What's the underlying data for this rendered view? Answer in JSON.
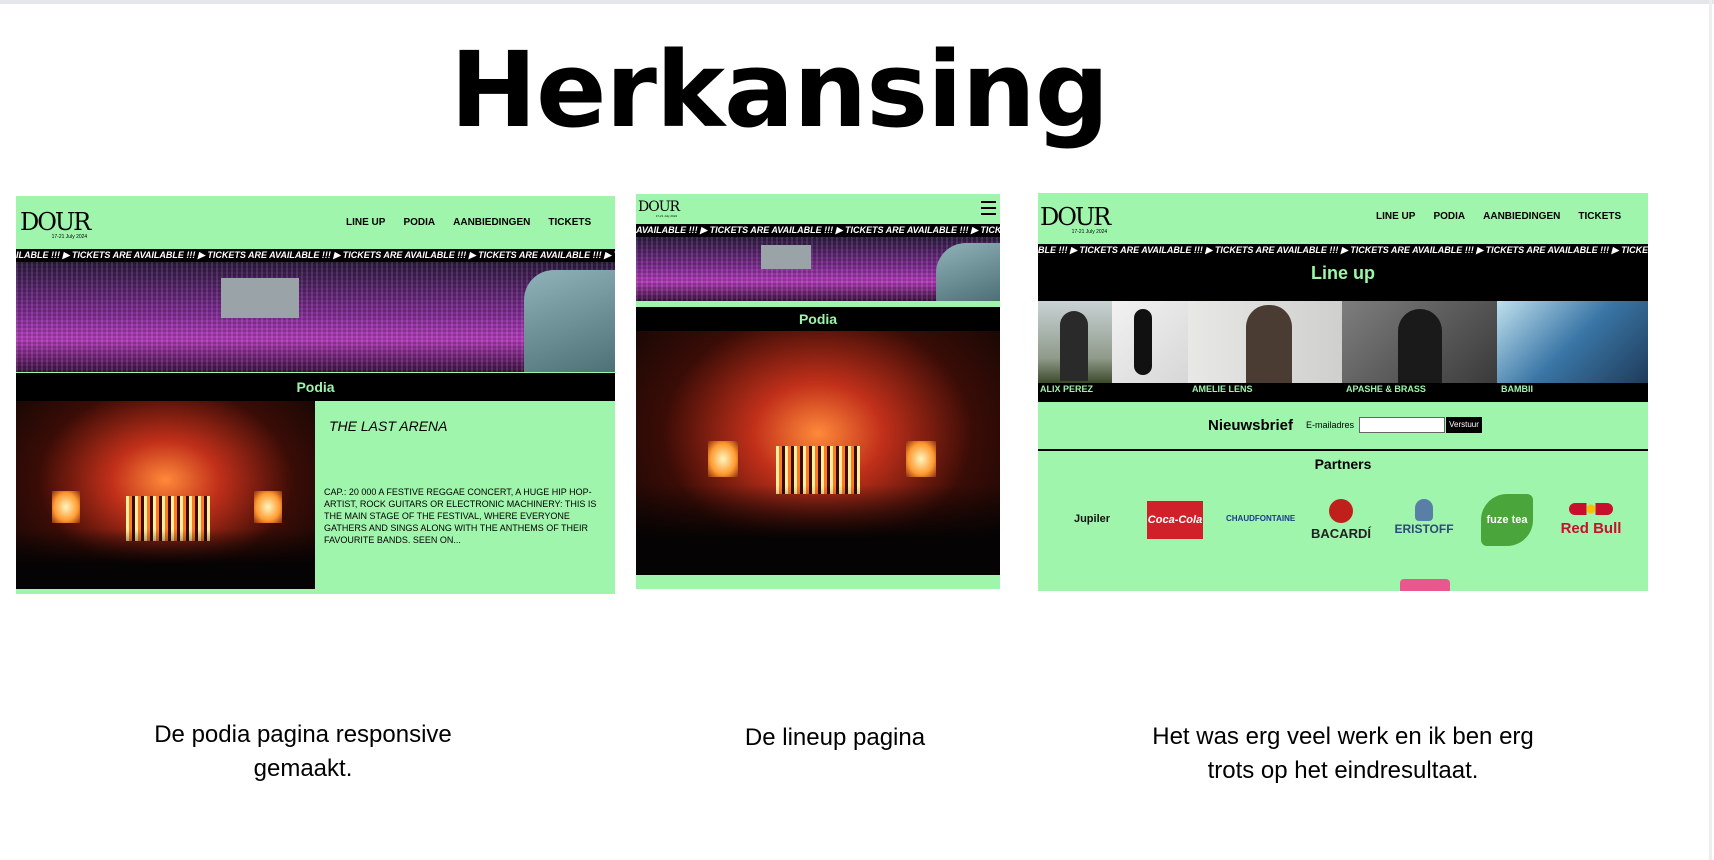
{
  "slide": {
    "title": "Herkansing",
    "captions": [
      "De podia pagina responsive gemaakt.",
      "De lineup pagina",
      "Het was erg veel werk en ik ben erg trots op het eindresultaat."
    ]
  },
  "site": {
    "logo": "DOUR",
    "logo_date": "17-21 July 2024",
    "logo_date_small": "17-21 July 2024",
    "nav": [
      "LINE UP",
      "PODIA",
      "AANBIEDINGEN",
      "TICKETS"
    ],
    "ticker_1": "ILABLE !!! ▶ TICKETS ARE AVAILABLE !!! ▶ TICKETS ARE AVAILABLE !!! ▶ TICKETS ARE AVAILABLE !!! ▶ TICKETS ARE AVAILABLE !!! ▶ TICKE",
    "ticker_2": "AVAILABLE !!! ▶ TICKETS ARE AVAILABLE !!! ▶ TICKETS ARE AVAILABLE !!! ▶ TICKETS",
    "ticker_3": "BLE !!! ▶ TICKETS ARE AVAILABLE !!! ▶ TICKETS ARE AVAILABLE !!! ▶ TICKETS ARE AVAILABLE !!! ▶ TICKETS ARE AVAILABLE !!! ▶ TICKETS A",
    "hamburger_icon": "hamburger-icon"
  },
  "podia": {
    "heading": "Podia",
    "stage_name": "THE LAST ARENA",
    "description": "CAP.: 20 000 A FESTIVE REGGAE CONCERT, A HUGE HIP HOP-ARTIST, ROCK GUITARS OR ELECTRONIC MACHINERY: THIS IS THE MAIN STAGE OF THE FESTIVAL, WHERE EVERYONE GATHERS AND SINGS ALONG WITH THE ANTHEMS OF THEIR FAVOURITE BANDS. SEEN ON..."
  },
  "lineup": {
    "heading": "Line up",
    "artists": [
      "ALIX PEREZ",
      "AMELIE LENS",
      "APASHE & BRASS",
      "BAMBII"
    ],
    "newsletter_label": "Nieuwsbrief",
    "email_label": "E-mailadres",
    "email_value": "",
    "submit_label": "Verstuur",
    "partners_heading": "Partners",
    "partners": [
      "Jupiler",
      "Coca-Cola",
      "CHAUDFONTAINE",
      "BACARDÍ",
      "ERISTOFF",
      "fuze tea",
      "Red Bull"
    ]
  }
}
